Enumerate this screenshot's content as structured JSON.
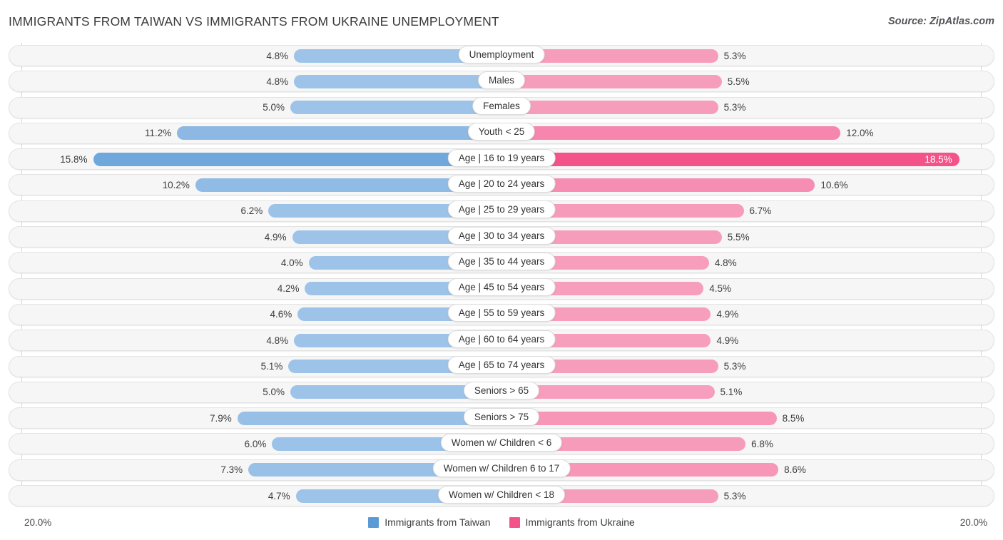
{
  "header": {
    "title": "IMMIGRANTS FROM TAIWAN VS IMMIGRANTS FROM UKRAINE UNEMPLOYMENT",
    "source": "Source: ZipAtlas.com"
  },
  "axis": {
    "left_limit": "20.0%",
    "right_limit": "20.0%"
  },
  "legend": {
    "items": [
      {
        "label": "Immigrants from Taiwan",
        "color": "#5b9bd5"
      },
      {
        "label": "Immigrants from Ukraine",
        "color": "#f4538a"
      }
    ]
  },
  "colors": {
    "left_base": "#9dc3e8",
    "left_strong": "#5b9bd5",
    "right_base": "#f79ebd",
    "right_strong": "#f4538a",
    "track": "#f6f6f6",
    "track_border": "#e3e3e3",
    "gridline": "#d8d8d8"
  },
  "chart_data": {
    "type": "bar",
    "title": "IMMIGRANTS FROM TAIWAN VS IMMIGRANTS FROM UKRAINE UNEMPLOYMENT",
    "subtitle": "",
    "orientation": "horizontal-diverging",
    "xlabel": "",
    "ylabel": "",
    "xlim": [
      20.0,
      20.0
    ],
    "unit": "%",
    "grid": false,
    "legend_position": "bottom-center",
    "categories": [
      "Unemployment",
      "Males",
      "Females",
      "Youth < 25",
      "Age | 16 to 19 years",
      "Age | 20 to 24 years",
      "Age | 25 to 29 years",
      "Age | 30 to 34 years",
      "Age | 35 to 44 years",
      "Age | 45 to 54 years",
      "Age | 55 to 59 years",
      "Age | 60 to 64 years",
      "Age | 65 to 74 years",
      "Seniors > 65",
      "Seniors > 75",
      "Women w/ Children < 6",
      "Women w/ Children 6 to 17",
      "Women w/ Children < 18"
    ],
    "series": [
      {
        "name": "Immigrants from Taiwan",
        "side": "left",
        "color": "#5b9bd5",
        "values": [
          4.8,
          4.8,
          5.0,
          11.2,
          15.8,
          10.2,
          6.2,
          4.9,
          4.0,
          4.2,
          4.6,
          4.8,
          5.1,
          5.0,
          7.9,
          6.0,
          7.3,
          4.7
        ],
        "labels": [
          "4.8%",
          "4.8%",
          "5.0%",
          "11.2%",
          "15.8%",
          "10.2%",
          "6.2%",
          "4.9%",
          "4.0%",
          "4.2%",
          "4.6%",
          "4.8%",
          "5.1%",
          "5.0%",
          "7.9%",
          "6.0%",
          "7.3%",
          "4.7%"
        ]
      },
      {
        "name": "Immigrants from Ukraine",
        "side": "right",
        "color": "#f4538a",
        "values": [
          5.3,
          5.5,
          5.3,
          12.0,
          18.5,
          10.6,
          6.7,
          5.5,
          4.8,
          4.5,
          4.9,
          4.9,
          5.3,
          5.1,
          8.5,
          6.8,
          8.6,
          5.3
        ],
        "labels": [
          "5.3%",
          "5.5%",
          "5.3%",
          "12.0%",
          "18.5%",
          "10.6%",
          "6.7%",
          "5.5%",
          "4.8%",
          "4.5%",
          "4.9%",
          "4.9%",
          "5.3%",
          "5.1%",
          "8.5%",
          "6.8%",
          "8.6%",
          "5.3%"
        ]
      }
    ]
  }
}
